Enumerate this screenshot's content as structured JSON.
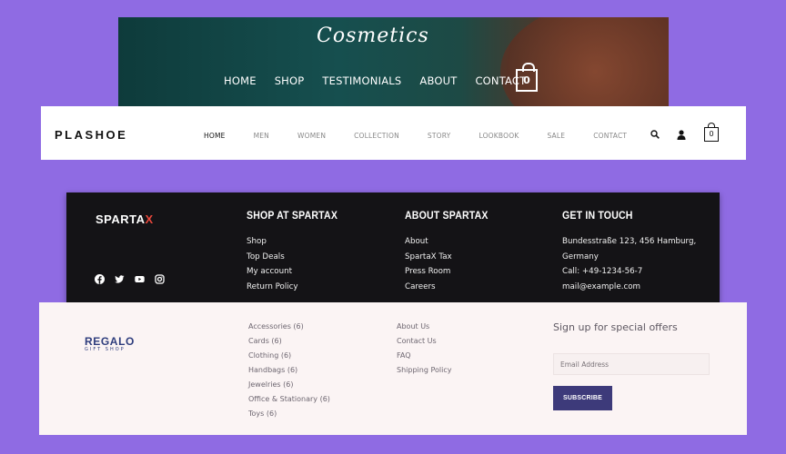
{
  "cosmetics": {
    "logo": "Cosmetics",
    "nav": [
      "HOME",
      "SHOP",
      "TESTIMONIALS",
      "ABOUT",
      "CONTACT"
    ],
    "cart_count": "0"
  },
  "plashoe": {
    "brand": "PLASHOE",
    "nav": [
      "HOME",
      "MEN",
      "WOMEN",
      "COLLECTION",
      "STORY",
      "LOOKBOOK",
      "SALE",
      "CONTACT"
    ],
    "cart_count": "0",
    "icons": [
      "search-icon",
      "user-icon",
      "bag-icon"
    ]
  },
  "spartax": {
    "brand_main": "SPARTA",
    "brand_accent": "X",
    "social_icons": [
      "facebook-icon",
      "twitter-icon",
      "youtube-icon",
      "instagram-icon"
    ],
    "columns": [
      {
        "title": "SHOP AT SPARTAX",
        "items": [
          "Shop",
          "Top Deals",
          "My account",
          "Return Policy"
        ]
      },
      {
        "title": "ABOUT SPARTAX",
        "items": [
          "About",
          "SpartaX Tax",
          "Press Room",
          "Careers"
        ]
      },
      {
        "title": "GET IN TOUCH",
        "items": [
          "Bundesstraße 123, 456 Hamburg,",
          "Germany",
          "Call: +49-1234-56-7",
          "mail@example.com"
        ]
      }
    ],
    "accent_color": "#e8473b"
  },
  "regalo": {
    "logo_main": "REGALO",
    "logo_sub": "GIFT SHOP",
    "categories": [
      "Accessories (6)",
      "Cards (6)",
      "Clothing (6)",
      "Handbags (6)",
      "Jewelries (6)",
      "Office & Stationary (6)",
      "Toys (6)"
    ],
    "links": [
      "About Us",
      "Contact Us",
      "FAQ",
      "Shipping Policy"
    ],
    "signup_title": "Sign up for special offers",
    "email_placeholder": "Email Address",
    "subscribe_label": "SUBSCRIBE",
    "button_color": "#3d3a7a"
  }
}
